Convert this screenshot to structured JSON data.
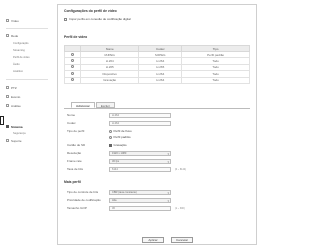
{
  "sidebar": {
    "items": [
      {
        "label": "Vídeo",
        "active": false
      },
      {
        "label": "Rede",
        "active": false
      },
      {
        "label": "Configuração",
        "active": false
      },
      {
        "label": "Streaming",
        "active": false
      },
      {
        "label": "Perfil de vídeo",
        "active": false
      },
      {
        "label": "Áudio",
        "active": false
      },
      {
        "label": "Analítico",
        "active": false
      },
      {
        "label": "Sistema",
        "active": true
      },
      {
        "label": "Segurança",
        "active": false
      },
      {
        "label": "Suporte",
        "active": false
      }
    ]
  },
  "page": {
    "title": "Configurações do perfil de vídeo",
    "top_checkbox_label": "Impor perfis em conexão de codificação digital"
  },
  "profile_section": {
    "title": "Perfil de vídeo",
    "columns": [
      "",
      "Nome",
      "Codec",
      "Tipo"
    ],
    "rows": [
      {
        "selected": true,
        "name": "MJPEG",
        "codec": "MJPEG",
        "type": "Perfil padrão"
      },
      {
        "selected": false,
        "name": "H.264",
        "codec": "H.264",
        "type": "Todo"
      },
      {
        "selected": false,
        "name": "H.265",
        "codec": "H.265",
        "type": "Todo"
      },
      {
        "selected": false,
        "name": "Dispositivo",
        "codec": "H.264",
        "type": "Todo"
      },
      {
        "selected": false,
        "name": "Gravação",
        "codec": "H.264",
        "type": "Todo"
      }
    ]
  },
  "tabs": [
    {
      "label": "Adicionar",
      "active": true
    },
    {
      "label": "Excluir",
      "active": false
    }
  ],
  "form": {
    "name": {
      "label": "Nome",
      "value": "H.264"
    },
    "codec": {
      "label": "Codec",
      "value": "H.264"
    },
    "type": {
      "label": "Tipo de perfil",
      "options": [
        "Perfil de fluxo",
        "Perfil padrão"
      ]
    },
    "stream": {
      "label": "Cartão de SD",
      "checkbox_label": "Gravação"
    },
    "resolution": {
      "label": "Resolução",
      "value": "1920 x 1080"
    },
    "framerate": {
      "label": "Frame rate",
      "value": "30 fps"
    },
    "bitrate": {
      "label": "Taxa de bits",
      "value": "6144",
      "note": "(0 ~ 6144)"
    }
  },
  "detail_section": {
    "title": "Mais perfil",
    "fields": [
      {
        "label": "Tipo de controle de bits",
        "value": "CBR (taxa constante)",
        "kind": "select"
      },
      {
        "label": "Prioridade de codificação",
        "value": "Alta",
        "kind": "select"
      },
      {
        "label": "Tamanho GOP",
        "value": "30",
        "kind": "input",
        "note": "(1 ~ 300)"
      },
      {
        "label": "Perfil",
        "value": "Alto",
        "kind": "select"
      },
      {
        "label": "Entropia",
        "value": "CABAC",
        "kind": "select"
      },
      {
        "label": "Largura de banda",
        "value": "6000",
        "kind": "input",
        "note": "(100 ~ 10000 kbps)"
      }
    ]
  },
  "buttons": {
    "apply": "Aplicar",
    "cancel": "Cancelar"
  }
}
